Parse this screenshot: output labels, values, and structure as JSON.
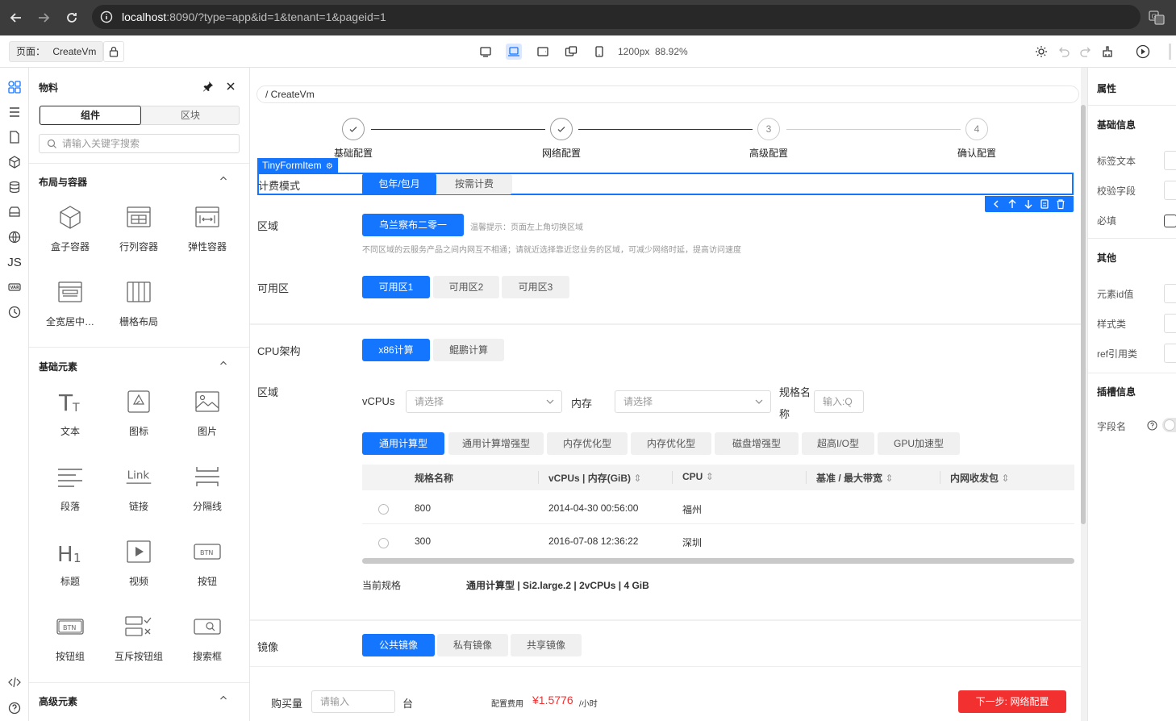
{
  "browser": {
    "url_host": "localhost",
    "url_rest": ":8090/?type=app&id=1&tenant=1&pageid=1"
  },
  "toolbar": {
    "page_label": "页面：",
    "page_name": "CreateVm",
    "width_text": "1200px",
    "zoom_text": "88.92%"
  },
  "materials": {
    "title": "物料",
    "tab_components": "组件",
    "tab_blocks": "区块",
    "search_placeholder": "请输入关键字搜索",
    "sections": [
      {
        "title": "布局与容器",
        "items": [
          "盒子容器",
          "行列容器",
          "弹性容器",
          "全宽居中…",
          "栅格布局"
        ]
      },
      {
        "title": "基础元素",
        "items": [
          "文本",
          "图标",
          "图片",
          "段落",
          "链接",
          "分隔线",
          "标题",
          "视频",
          "按钮",
          "按钮组",
          "互斥按钮组",
          "搜索框"
        ]
      },
      {
        "title": "高级元素",
        "items": []
      }
    ]
  },
  "canvas": {
    "breadcrumb": "/ CreateVm",
    "steps": [
      {
        "label": "基础配置",
        "mark": "✓"
      },
      {
        "label": "网络配置",
        "mark": "✓"
      },
      {
        "label": "高级配置",
        "mark": "3"
      },
      {
        "label": "确认配置",
        "mark": "4"
      }
    ],
    "selected_tag": "TinyFormItem",
    "billing": {
      "label": "计费模式",
      "options": [
        "包年/包月",
        "按需计费"
      ]
    },
    "region": {
      "label": "区域",
      "value": "乌兰察布二零一",
      "tip": "温馨提示：页面左上角切换区域",
      "desc": "不同区域的云服务产品之间内网互不相通；请就近选择靠近您业务的区域，可减少网络时延，提高访问速度"
    },
    "zone": {
      "label": "可用区",
      "options": [
        "可用区1",
        "可用区2",
        "可用区3"
      ]
    },
    "cpu_arch": {
      "label": "CPU架构",
      "options": [
        "x86计算",
        "鲲鹏计算"
      ]
    },
    "spec": {
      "label": "区域",
      "vcpus_label": "vCPUs",
      "vcpus_placeholder": "请选择",
      "mem_label": "内存",
      "mem_placeholder": "请选择",
      "name_label_1": "规格名",
      "name_label_2": "称",
      "name_placeholder": "输入:Q",
      "types": [
        "通用计算型",
        "通用计算增强型",
        "内存优化型",
        "内存优化型",
        "磁盘增强型",
        "超高I/O型",
        "GPU加速型"
      ],
      "columns": [
        "规格名称",
        "vCPUs | 内存(GiB)",
        "CPU",
        "基准 / 最大带宽",
        "内网收发包"
      ],
      "rows": [
        {
          "name": "800",
          "vcpu": "2014-04-30 00:56:00",
          "cpu": "福州"
        },
        {
          "name": "300",
          "vcpu": "2016-07-08 12:36:22",
          "cpu": "深圳"
        }
      ],
      "current_label": "当前规格",
      "current_value": "通用计算型 | Si2.large.2 | 2vCPUs | 4 GiB"
    },
    "image": {
      "label": "镜像",
      "options": [
        "公共镜像",
        "私有镜像",
        "共享镜像"
      ]
    },
    "footer": {
      "qty_label": "购买量",
      "qty_placeholder": "请输入",
      "unit": "台",
      "fee_label": "配置费用",
      "fee_value": "¥1.5776",
      "fee_unit": "/小时",
      "next_button": "下一步: 网络配置"
    }
  },
  "props": {
    "title": "属性",
    "basic_title": "基础信息",
    "basic_fields": [
      "标签文本",
      "校验字段",
      "必填"
    ],
    "other_title": "其他",
    "other_fields": [
      "元素id值",
      "样式类",
      "ref引用类"
    ],
    "slot_title": "插槽信息",
    "slot_fields": [
      "字段名"
    ]
  },
  "colors": {
    "accent": "#1476ff",
    "danger": "#f23030",
    "chrome": "#3c3c3c"
  }
}
